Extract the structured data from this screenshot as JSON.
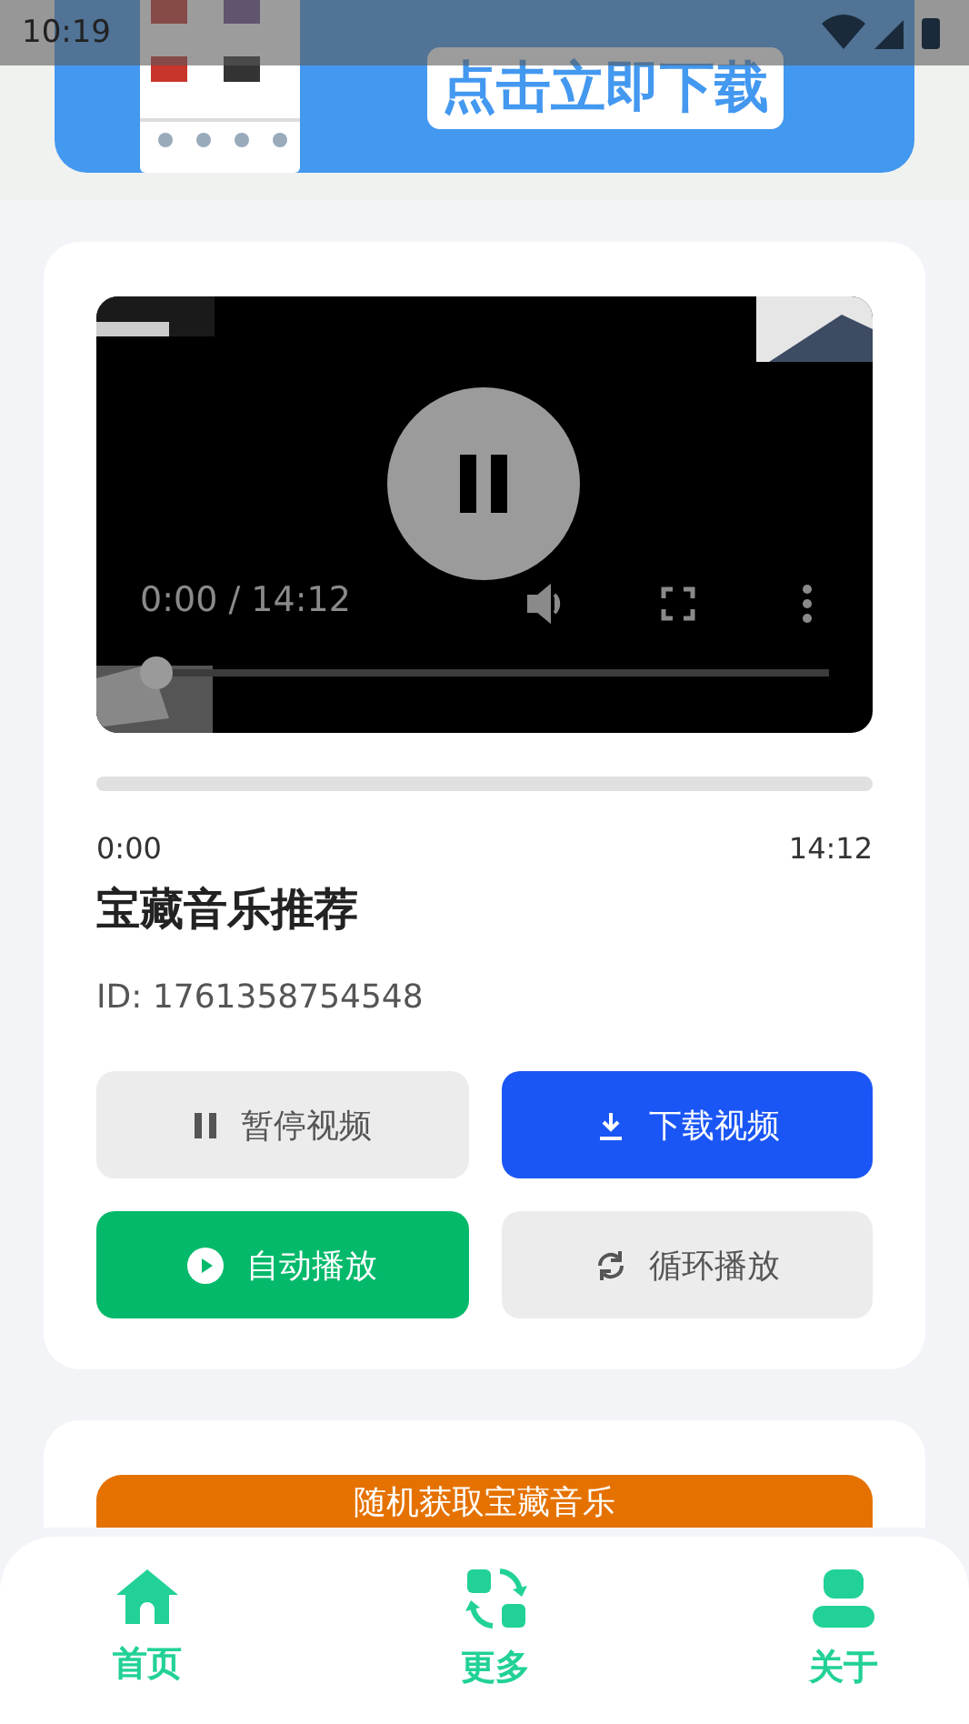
{
  "status_bar": {
    "time": "10:19"
  },
  "banner": {
    "button": "点击立即下载"
  },
  "player": {
    "time": "0:00 / 14:12",
    "seek": {
      "level": 0.02
    }
  },
  "progress": {
    "level": 0,
    "start": "0:00",
    "end": "14:12"
  },
  "title": "宝藏音乐推荐",
  "id_text": "ID: 1761358754548",
  "actions": [
    {
      "label": "暂停视频",
      "kind": "pause",
      "color": "#ececec"
    },
    {
      "label": "下载视频",
      "kind": "download",
      "color": "#1a56f5"
    },
    {
      "label": "自动播放",
      "kind": "play",
      "color": "#05b96b"
    },
    {
      "label": "循环播放",
      "kind": "loop",
      "color": "#ececec"
    }
  ],
  "random_button": "随机获取宝藏音乐",
  "nav": [
    {
      "label": "首页",
      "kind": "home"
    },
    {
      "label": "更多",
      "kind": "more"
    },
    {
      "label": "关于",
      "kind": "about"
    }
  ]
}
